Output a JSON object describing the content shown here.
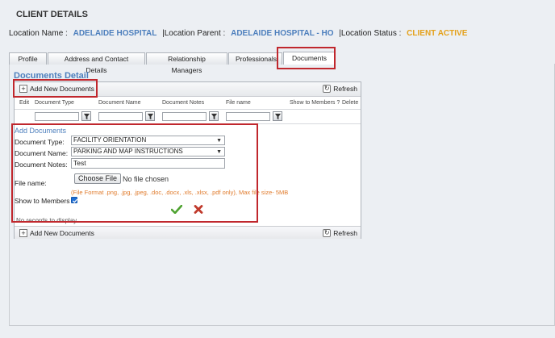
{
  "page": {
    "title": "CLIENT DETAILS"
  },
  "location": {
    "name_label": "Location Name :",
    "name_value": "ADELAIDE HOSPITAL",
    "parent_label": "|Location Parent :",
    "parent_value": "ADELAIDE HOSPITAL - HO",
    "status_label": "|Location Status :",
    "status_value": "CLIENT ACTIVE"
  },
  "tabs": [
    {
      "label": "Profile"
    },
    {
      "label": "Address and Contact Details"
    },
    {
      "label": "Relationship Managers"
    },
    {
      "label": "Professionals"
    },
    {
      "label": "Documents"
    }
  ],
  "documents": {
    "heading": "Documents Detail",
    "add_label": "Add New Documents",
    "refresh_label": "Refresh",
    "columns": {
      "edit": "Edit",
      "type": "Document Type",
      "name": "Document Name",
      "notes": "Document Notes",
      "file": "File name",
      "show": "Show to Members ?",
      "delete": "Delete"
    },
    "empty_message": "No records to display."
  },
  "form": {
    "title": "Add Documents",
    "type_label": "Document Type:",
    "type_value": "FACILITY ORIENTATION",
    "name_label": "Document Name:",
    "name_value": "PARKING AND MAP INSTRUCTIONS",
    "notes_label": "Document Notes:",
    "notes_value": "Test",
    "file_label": "File name:",
    "file_button": "Choose File",
    "file_status": "No file chosen",
    "file_hint": "(File Format .png, .jpg, .jpeg, .doc, .docx, .xls, .xlsx, .pdf only), Max file size- 5MB",
    "show_label": "Show to Members ?"
  },
  "colors": {
    "accent_blue": "#4d7fbd",
    "status_orange": "#e4a11b",
    "highlight_red": "#c0272d",
    "hint_orange": "#e07b2c"
  }
}
